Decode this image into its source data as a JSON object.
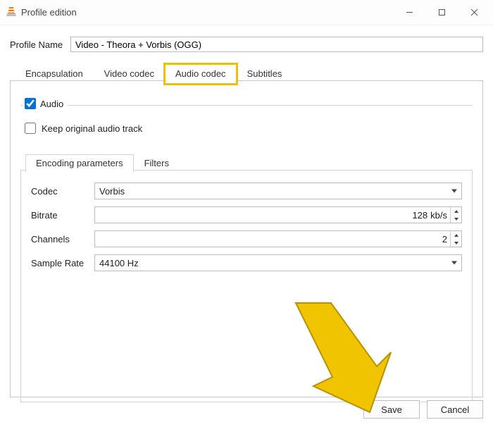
{
  "window": {
    "title": "Profile edition"
  },
  "profile": {
    "name_label": "Profile Name",
    "name_value": "Video - Theora + Vorbis (OGG)"
  },
  "tabs": {
    "encapsulation": "Encapsulation",
    "video_codec": "Video codec",
    "audio_codec": "Audio codec",
    "subtitles": "Subtitles"
  },
  "audio_panel": {
    "audio_label": "Audio",
    "audio_checked": true,
    "keep_original_label": "Keep original audio track",
    "keep_original_checked": false,
    "inner_tabs": {
      "encoding": "Encoding parameters",
      "filters": "Filters"
    },
    "fields": {
      "codec_label": "Codec",
      "codec_value": "Vorbis",
      "bitrate_label": "Bitrate",
      "bitrate_value": "128",
      "bitrate_unit": "kb/s",
      "channels_label": "Channels",
      "channels_value": "2",
      "samplerate_label": "Sample Rate",
      "samplerate_value": "44100 Hz"
    }
  },
  "footer": {
    "save": "Save",
    "cancel": "Cancel"
  }
}
